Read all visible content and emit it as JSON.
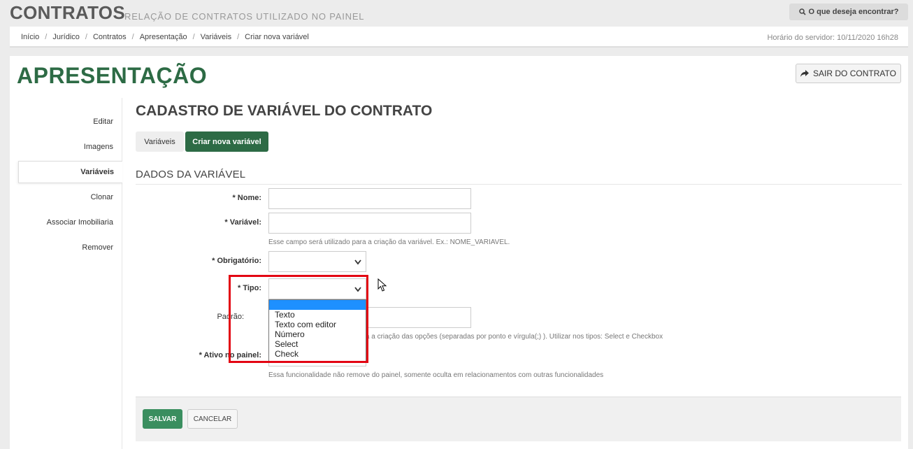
{
  "header": {
    "title": "CONTRATOS",
    "subtitle": "RELAÇÃO DE CONTRATOS UTILIZADO NO PAINEL",
    "search_label": "O que deseja encontrar?"
  },
  "breadcrumb": {
    "items": [
      "Início",
      "Jurídico",
      "Contratos",
      "Apresentação",
      "Variáveis",
      "Criar nova variável"
    ],
    "server_time": "Horário do servidor: 10/11/2020 16h28"
  },
  "page": {
    "title": "APRESENTAÇÃO",
    "exit_label": "SAIR DO CONTRATO"
  },
  "sidebar": {
    "items": [
      {
        "label": "Editar"
      },
      {
        "label": "Imagens"
      },
      {
        "label": "Variáveis",
        "active": true
      },
      {
        "label": "Clonar"
      },
      {
        "label": "Associar Imobiliaria"
      },
      {
        "label": "Remover"
      }
    ]
  },
  "form": {
    "section_title": "CADASTRO DE VARIÁVEL DO CONTRATO",
    "tabs": [
      {
        "label": "Variáveis"
      },
      {
        "label": "Criar nova variável",
        "active": true
      }
    ],
    "fieldset_title": "DADOS DA VARIÁVEL",
    "fields": {
      "nome": {
        "label": "* Nome:",
        "value": ""
      },
      "variavel": {
        "label": "* Variável:",
        "value": "",
        "help": "Esse campo será utilizado para a criação da variável. Ex.: NOME_VARIAVEL."
      },
      "obrigatorio": {
        "label": "* Obrigatório:",
        "value": ""
      },
      "tipo": {
        "label": "* Tipo:",
        "value": "",
        "options": [
          "Texto",
          "Texto com editor",
          "Número",
          "Select",
          "Check"
        ]
      },
      "padrao": {
        "label": "Padrão:",
        "value": "",
        "help": "ara a criação das opções (separadas por ponto e vírgula(;) ). Utilizar nos tipos: Select e Checkbox"
      },
      "ativo": {
        "label": "* Ativo no painel:",
        "value": "",
        "help": "Essa funcionalidade não remove do painel, somente oculta em relacionamentos com outras funcionalidades"
      }
    },
    "save_label": "SALVAR",
    "cancel_label": "CANCELAR"
  },
  "colors": {
    "brand_green": "#2d6b45",
    "save_green": "#3a8e5f",
    "highlight_red": "#e30613",
    "dropdown_highlight": "#1e90ff"
  }
}
